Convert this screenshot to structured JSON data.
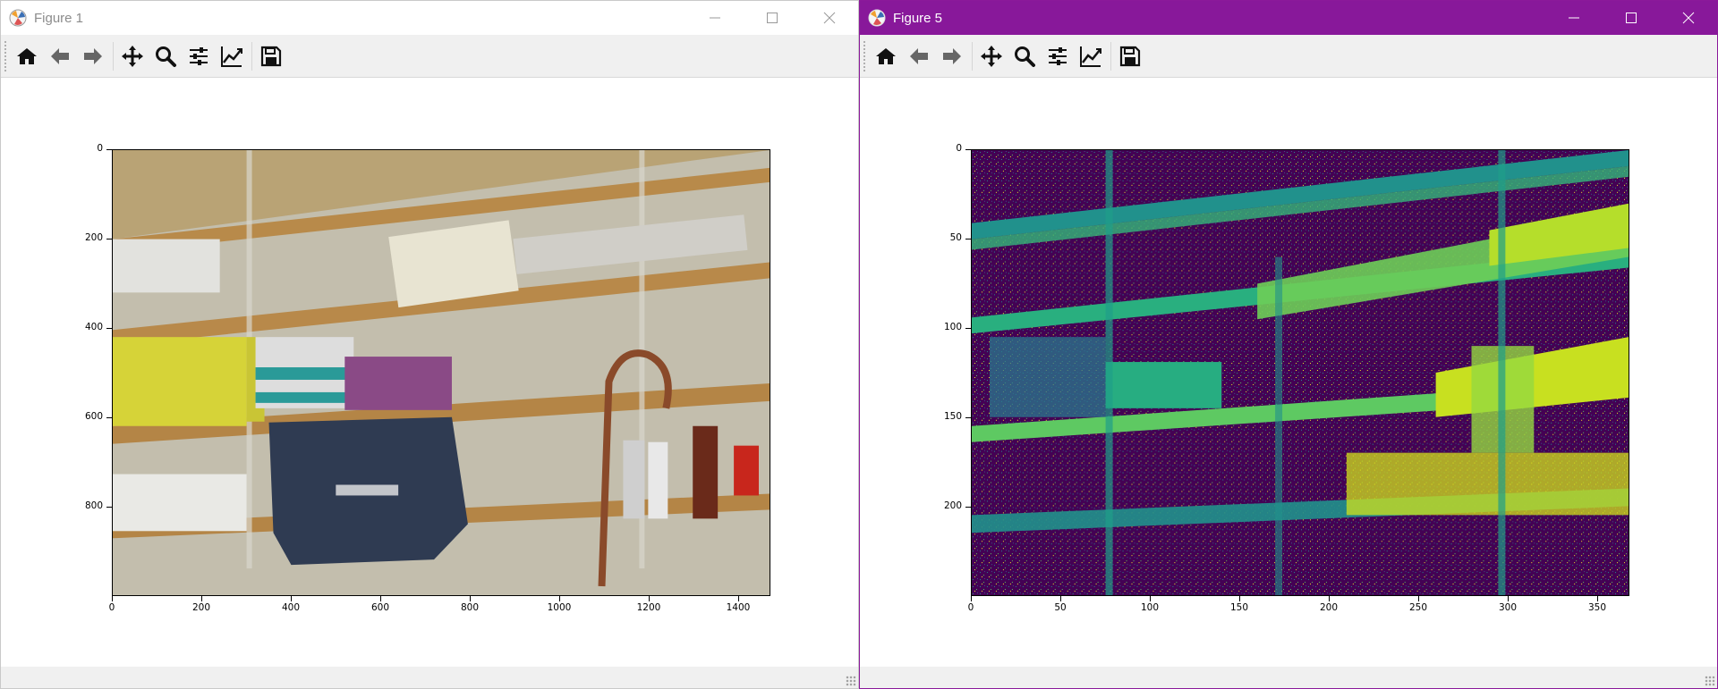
{
  "windows": [
    {
      "title": "Figure 1",
      "yticks": [
        "0",
        "200",
        "400",
        "600",
        "800"
      ],
      "xticks": [
        "0",
        "200",
        "400",
        "600",
        "800",
        "1000",
        "1200",
        "1400"
      ],
      "image": "shelves-photo"
    },
    {
      "title": "Figure 5",
      "yticks": [
        "0",
        "50",
        "100",
        "150",
        "200"
      ],
      "xticks": [
        "0",
        "50",
        "100",
        "150",
        "200",
        "250",
        "300",
        "350"
      ],
      "image": "viridis-disparity-map"
    }
  ],
  "toolbar": [
    {
      "name": "home-button",
      "icon": "home-icon"
    },
    {
      "name": "back-button",
      "icon": "arrow-left-icon"
    },
    {
      "name": "forward-button",
      "icon": "arrow-right-icon"
    },
    {
      "name": "pan-button",
      "icon": "move-icon"
    },
    {
      "name": "zoom-button",
      "icon": "magnifier-icon"
    },
    {
      "name": "configure-subplots-button",
      "icon": "sliders-icon"
    },
    {
      "name": "edit-axis-button",
      "icon": "line-chart-icon"
    },
    {
      "name": "save-button",
      "icon": "floppy-disk-icon"
    }
  ],
  "colors": {
    "active_titlebar": "#88189a",
    "viridis_dark": "#440154",
    "viridis_teal": "#21918c",
    "viridis_green": "#5ec962",
    "viridis_yellow": "#fde725"
  }
}
